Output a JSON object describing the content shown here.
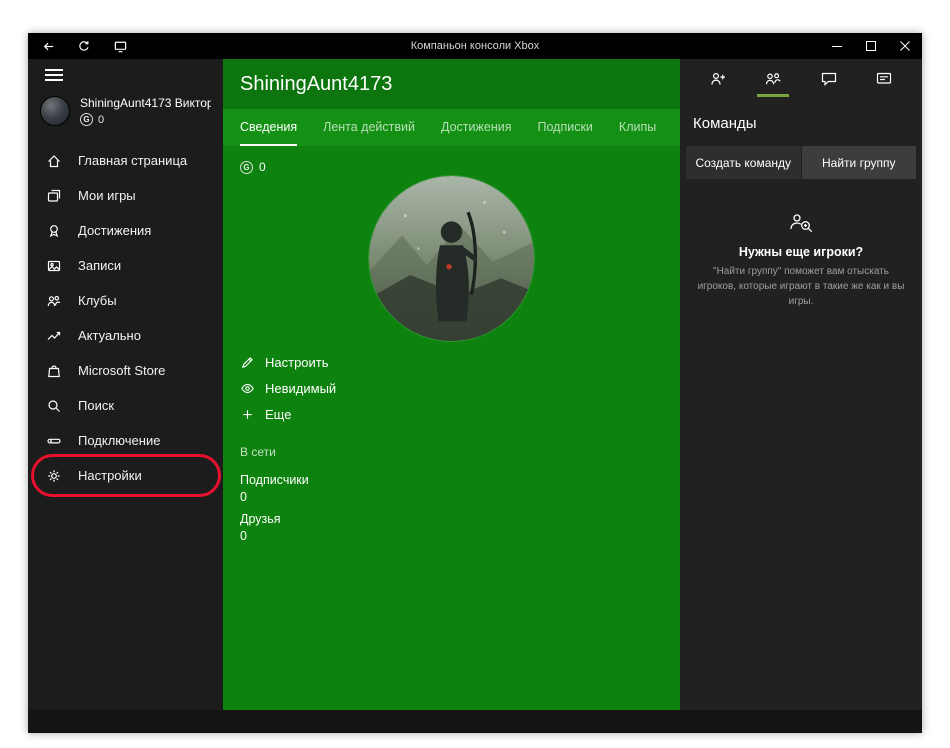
{
  "titlebar": {
    "title": "Компаньон консоли Xbox"
  },
  "colors": {
    "xbox_green": "#107c10",
    "annotation_red": "#e8112d",
    "active_underline": "#7ba63c"
  },
  "sidebar": {
    "profile": {
      "name": "ShiningAunt4173 Виктор...",
      "gamerscore_icon": "G",
      "gamerscore": "0"
    },
    "items": [
      {
        "label": "Главная страница",
        "icon": "home-icon"
      },
      {
        "label": "Мои игры",
        "icon": "games-icon"
      },
      {
        "label": "Достижения",
        "icon": "achievements-icon"
      },
      {
        "label": "Записи",
        "icon": "captures-icon"
      },
      {
        "label": "Клубы",
        "icon": "clubs-icon"
      },
      {
        "label": "Актуально",
        "icon": "trending-icon"
      },
      {
        "label": "Microsoft Store",
        "icon": "store-icon"
      },
      {
        "label": "Поиск",
        "icon": "search-icon"
      },
      {
        "label": "Подключение",
        "icon": "connection-icon"
      },
      {
        "label": "Настройки",
        "icon": "settings-icon",
        "annotated": true
      }
    ]
  },
  "profile_panel": {
    "gamertag": "ShiningAunt4173",
    "tabs": [
      {
        "label": "Сведения",
        "active": true
      },
      {
        "label": "Лента действий",
        "active": false
      },
      {
        "label": "Достижения",
        "active": false
      },
      {
        "label": "Подписки",
        "active": false
      },
      {
        "label": "Клипы",
        "active": false
      }
    ],
    "gamerscore_icon": "G",
    "gamerscore": "0",
    "actions": [
      {
        "label": "Настроить",
        "icon": "pencil-icon"
      },
      {
        "label": "Невидимый",
        "icon": "eye-icon"
      },
      {
        "label": "Еще",
        "icon": "plus-icon"
      }
    ],
    "status": "В сети",
    "stats": [
      {
        "label": "Подписчики",
        "value": "0"
      },
      {
        "label": "Друзья",
        "value": "0"
      }
    ]
  },
  "social_panel": {
    "title": "Команды",
    "tabs": [
      {
        "label": "Создать команду"
      },
      {
        "label": "Найти группу"
      }
    ],
    "empty_state": {
      "title": "Нужны еще игроки?",
      "description": "\"Найти группу\" поможет вам отыскать игроков, которые играют в такие же как и вы игры."
    }
  }
}
